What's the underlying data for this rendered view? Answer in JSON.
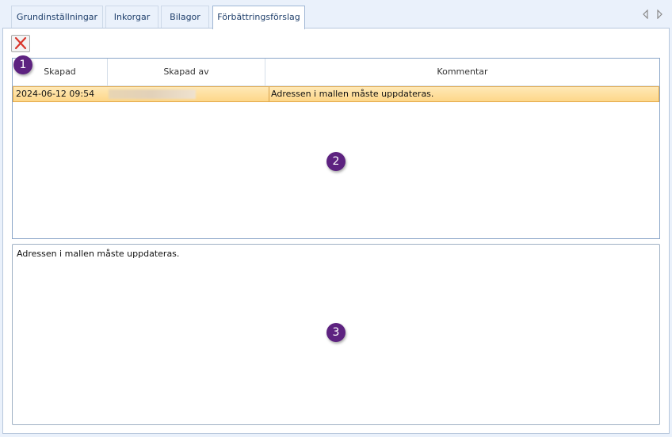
{
  "tabs": [
    {
      "label": "Grundinställningar"
    },
    {
      "label": "Inkorgar"
    },
    {
      "label": "Bilagor"
    },
    {
      "label": "Förbättringsförslag"
    }
  ],
  "grid": {
    "columns": [
      "Skapad",
      "Skapad av",
      "Kommentar"
    ],
    "rows": [
      {
        "created": "2024-06-12 09:54",
        "created_by": "",
        "comment": "Adressen i mallen måste uppdateras."
      }
    ]
  },
  "comment_box": {
    "text": "Adressen i mallen måste uppdateras."
  },
  "badges": [
    "1",
    "2",
    "3"
  ],
  "colors": {
    "accent": "#5d2280",
    "selection": "#fdd789",
    "delete": "#d9362b"
  },
  "icons": {
    "delete": "close-icon",
    "prev": "arrow-left-icon",
    "next": "arrow-right-icon"
  }
}
